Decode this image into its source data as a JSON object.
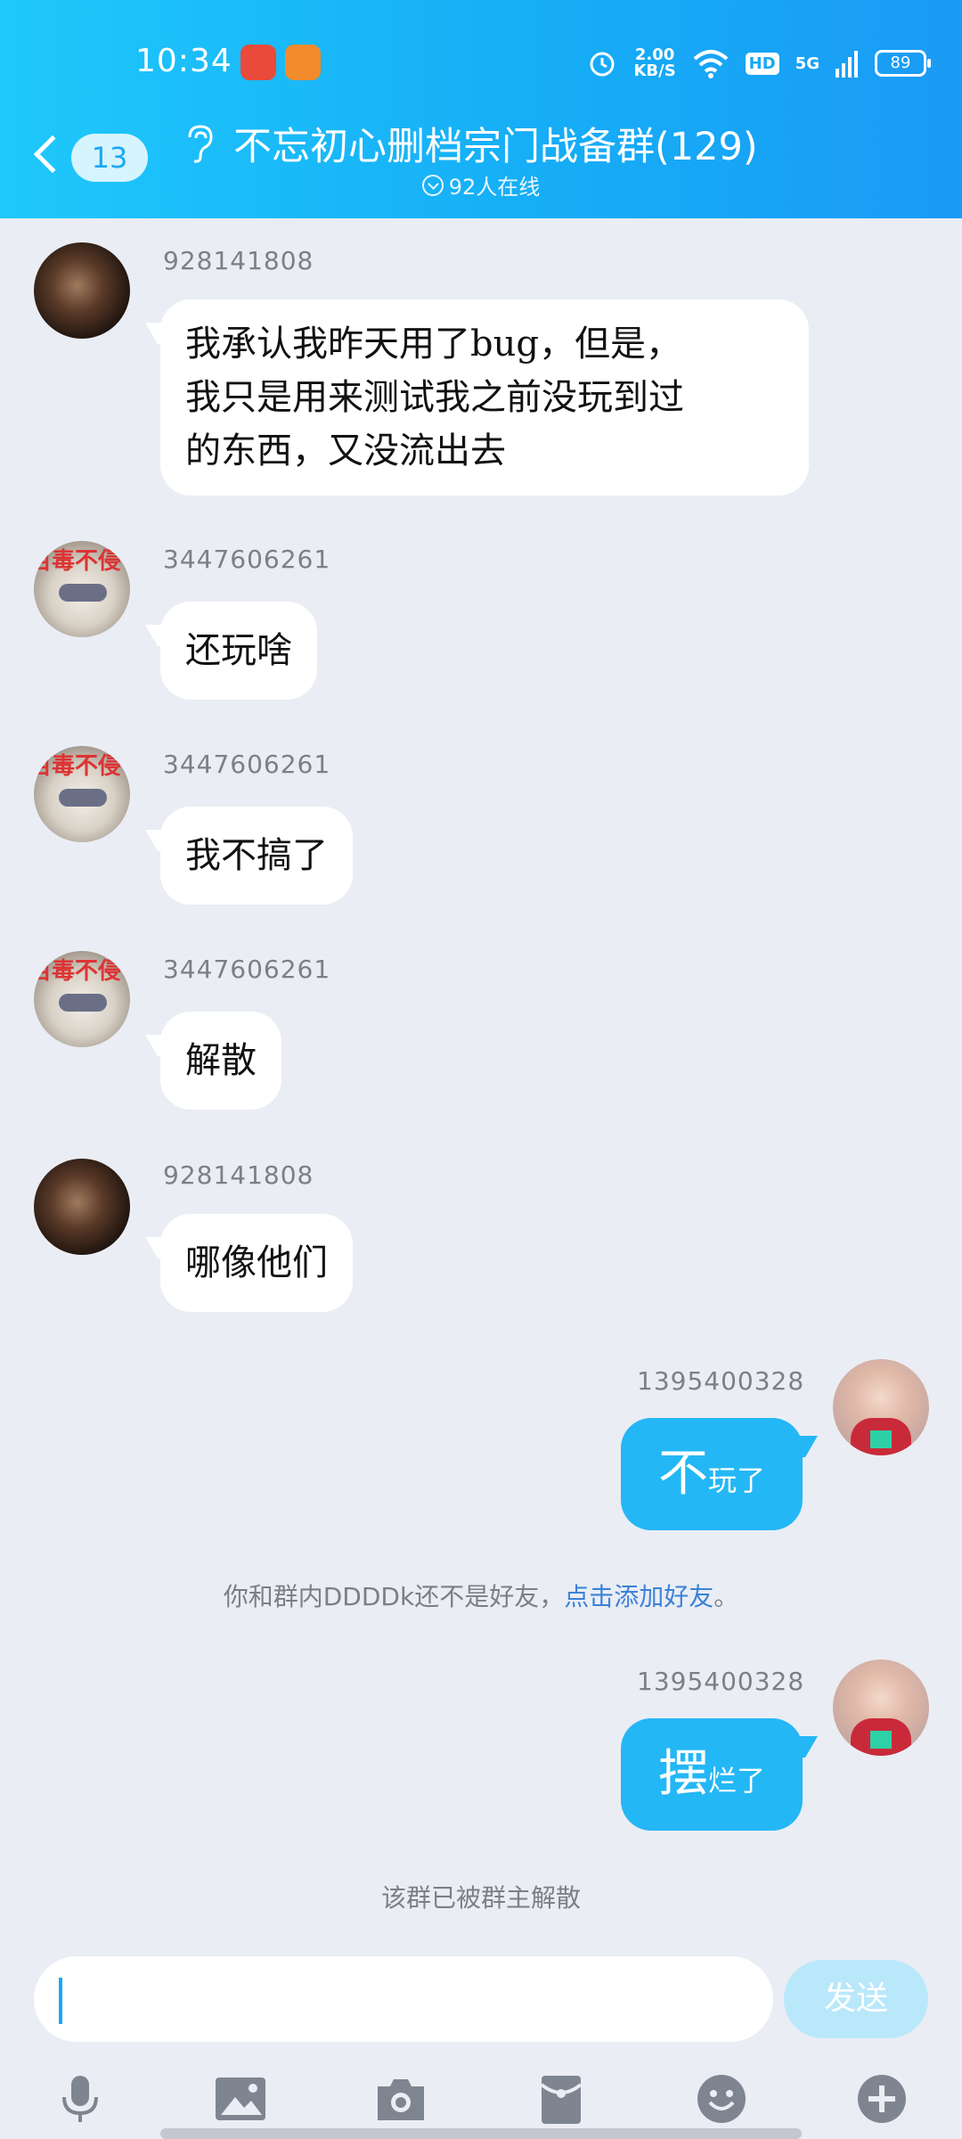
{
  "status_bar": {
    "time": "10:34",
    "net_speed_value": "2.00",
    "net_speed_unit": "KB/S",
    "hd": "HD",
    "signal": "5G",
    "battery": "89"
  },
  "header": {
    "back_count": "13",
    "group_title": "不忘初心删档宗门战备群(129)",
    "online_text": "92人在线"
  },
  "messages": [
    {
      "sender": "928141808",
      "text_lines": [
        "我承认我昨天用了bug，但是，",
        "我只是用来测试我之前没玩到过",
        "的东西，又没流出去"
      ]
    },
    {
      "sender": "3447606261",
      "text": "还玩啥"
    },
    {
      "sender": "3447606261",
      "text": "我不搞了"
    },
    {
      "sender": "3447606261",
      "text": "解散"
    },
    {
      "sender": "928141808",
      "text": "哪像他们"
    },
    {
      "sender": "1395400328",
      "text_big": "不",
      "text_small": "玩了"
    },
    {
      "sender": "1395400328",
      "text_big": "摆",
      "text_small": "烂了"
    }
  ],
  "avatars": {
    "dog_sticker": "百毒不侵"
  },
  "system": {
    "friend_notice_prefix": "你和群内DDDDk还不是好友，",
    "friend_notice_link": "点击添加好友",
    "friend_notice_suffix": "。",
    "disbanded": "该群已被群主解散"
  },
  "input": {
    "send_label": "发送"
  },
  "colors": {
    "header_gradient_start": "#1fc8fb",
    "header_gradient_end": "#1a9bf5",
    "self_bubble": "#24b7f5",
    "send_disabled": "#b9e8fb",
    "link": "#3b82d8"
  },
  "toolbar_icons": [
    "microphone-icon",
    "image-icon",
    "camera-icon",
    "red-packet-icon",
    "emoji-icon",
    "plus-icon"
  ]
}
